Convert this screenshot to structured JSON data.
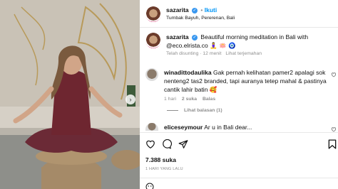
{
  "header": {
    "username": "sazarita",
    "follow_label": "Ikuti",
    "location": "Tumbak Bayuh, Pererenan, Bali"
  },
  "caption": {
    "username": "sazarita",
    "text": "Beautiful morning meditation in Bali with",
    "mention": "@eco.elrista.co",
    "emojis": "🧘‍♀️ 🪷 🧿",
    "time": "Telah disunting · 12 menit",
    "translate": "Lihat terjemahan"
  },
  "comments": [
    {
      "username": "winadittodaulika",
      "text": "Gak pernah kelihatan pamer2 apalagi sok nenteng2 tas2 branded, tapi auranya tetep mahal & pastinya cantik lahir batin 🥰",
      "time": "1 hari",
      "likes": "2 suka",
      "reply": "Balas",
      "view_replies": "Lihat balasan (1)"
    },
    {
      "username": "eliceseymour",
      "text": "Ar u in Bali dear..."
    }
  ],
  "actions": {
    "likes": "7.388 suka",
    "time": "1 HARI YANG LALU"
  }
}
